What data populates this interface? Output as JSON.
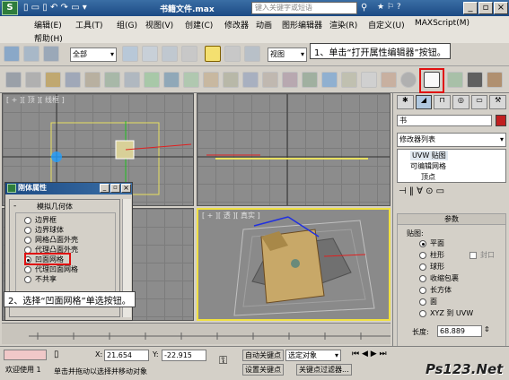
{
  "title_bar": {
    "logo": "S",
    "filename": "书籍文件.max",
    "search_placeholder": "键入关键字或短语"
  },
  "menu": [
    {
      "label": "编辑(E)"
    },
    {
      "label": "工具(T)"
    },
    {
      "label": "组(G)"
    },
    {
      "label": "视图(V)"
    },
    {
      "label": "创建(C)"
    },
    {
      "label": "修改器"
    },
    {
      "label": "动画"
    },
    {
      "label": "图形编辑器"
    },
    {
      "label": "渲染(R)"
    },
    {
      "label": "自定义(U)"
    },
    {
      "label": "MAXScript(M)"
    },
    {
      "label": "帮助(H)"
    }
  ],
  "toolbar": {
    "selection_filter": "全部",
    "reference_coord": "视图"
  },
  "viewports": {
    "top_left": "[ + ][ 顶 ][ 线框 ]",
    "top_right": "",
    "bottom_left": "",
    "bottom_right": "[ + ][ 透 ][ 真实 ]"
  },
  "command_panel": {
    "object_name": "书",
    "modifier_list": "修改器列表",
    "stack": [
      "UVW 贴图",
      "可编辑网格",
      "顶点"
    ],
    "rollout_title": "参数",
    "mapping_label": "贴图:",
    "mapping_options": [
      {
        "label": "平面",
        "checked": true
      },
      {
        "label": "柱形",
        "checked": false
      },
      {
        "label": "球形",
        "checked": false
      },
      {
        "label": "收缩包裹",
        "checked": false
      },
      {
        "label": "长方体",
        "checked": false
      },
      {
        "label": "面",
        "checked": false
      },
      {
        "label": "XYZ 到 UVW",
        "checked": false
      }
    ],
    "cap_label": "封口",
    "length_label": "长度:",
    "length_value": "68.889"
  },
  "dialog": {
    "title": "刚体属性",
    "group_title": "模拟几何体",
    "options": [
      {
        "label": "边界框",
        "checked": false
      },
      {
        "label": "边界球体",
        "checked": false
      },
      {
        "label": "网格凸面外壳",
        "checked": false
      },
      {
        "label": "代理凸面外壳",
        "checked": false
      },
      {
        "label": "凹面网格",
        "checked": true
      },
      {
        "label": "代理凹面网格",
        "checked": false
      },
      {
        "label": "不共享",
        "checked": false
      }
    ]
  },
  "callouts": {
    "step1": "1、单击“打开属性编辑器”按钮。",
    "step2": "2、选择“凹面网格”单选按钮。"
  },
  "status": {
    "welcome": "欢迎使用 1",
    "x_label": "X:",
    "x_value": "21.654",
    "y_label": "Y:",
    "y_value": "-22.915",
    "auto_key": "自动关键点",
    "selected": "选定对象",
    "set_key": "设置关键点",
    "key_filters": "关键点过滤器...",
    "prompt": "单击并拖动以选择并移动对象"
  },
  "watermark": "Ps123.Net",
  "colors": {
    "red_highlight": "#e01010",
    "viewport_active": "#f0e040"
  }
}
